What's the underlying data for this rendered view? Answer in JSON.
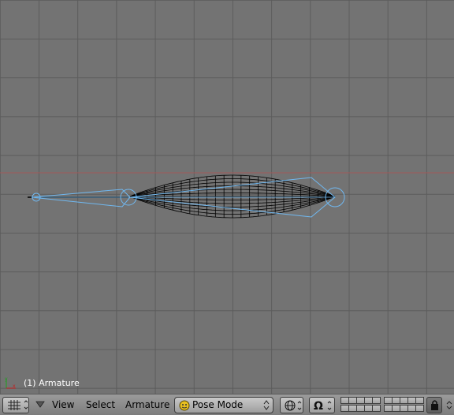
{
  "viewport": {
    "background": "#737373",
    "grid_color": "#5c5c5c",
    "x_axis_color": "#a05a5a",
    "bone_color": "#70b8f0",
    "mesh_color": "#000000"
  },
  "status": {
    "object_info": "(1) Armature"
  },
  "header": {
    "editor_type_icon": "grid-icon",
    "menus": [
      "View",
      "Select",
      "Armature"
    ],
    "mode": {
      "icon": "pose-mode-icon",
      "label": "Pose Mode"
    },
    "draw_type_icon": "wireframe-sphere-icon",
    "pivot_icon": "magnet-icon",
    "lock_icon": "lock-icon"
  }
}
